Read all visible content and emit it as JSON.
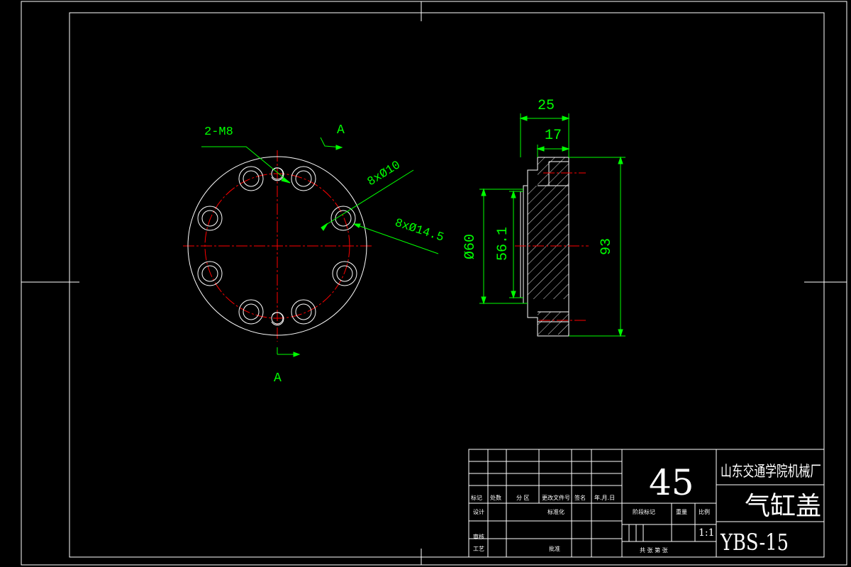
{
  "front_view": {
    "label_2m8": "2-M8",
    "section_top": "A",
    "section_bottom": "A",
    "label_8x10": "8xØ10",
    "label_8x14_5": "8xØ14.5"
  },
  "side_view": {
    "dim_25": "25",
    "dim_17": "17",
    "dim_60": "Ø60",
    "dim_56_1": "56.1",
    "dim_93": "93"
  },
  "title_block": {
    "material": "45",
    "company": "山东交通学院机械厂",
    "part_name": "气缸盖",
    "drawing_no": "YBS-15",
    "scale": "1:1",
    "h_mark": "标记",
    "h_count": "处数",
    "h_zone": "分 区",
    "h_doc": "更改文件号",
    "h_sign": "签名",
    "h_date": "年.月.日",
    "h_design": "设计",
    "h_std": "标准化",
    "h_review": "审核",
    "h_process": "工艺",
    "h_approve": "批准",
    "h_stage": "阶段标记",
    "h_weight": "重量",
    "h_ratio": "比例",
    "h_sheets": "共  张  第  张"
  },
  "colors": {
    "outline": "#ffffff",
    "dimension": "#00ff00",
    "centerline": "#ff0000"
  }
}
